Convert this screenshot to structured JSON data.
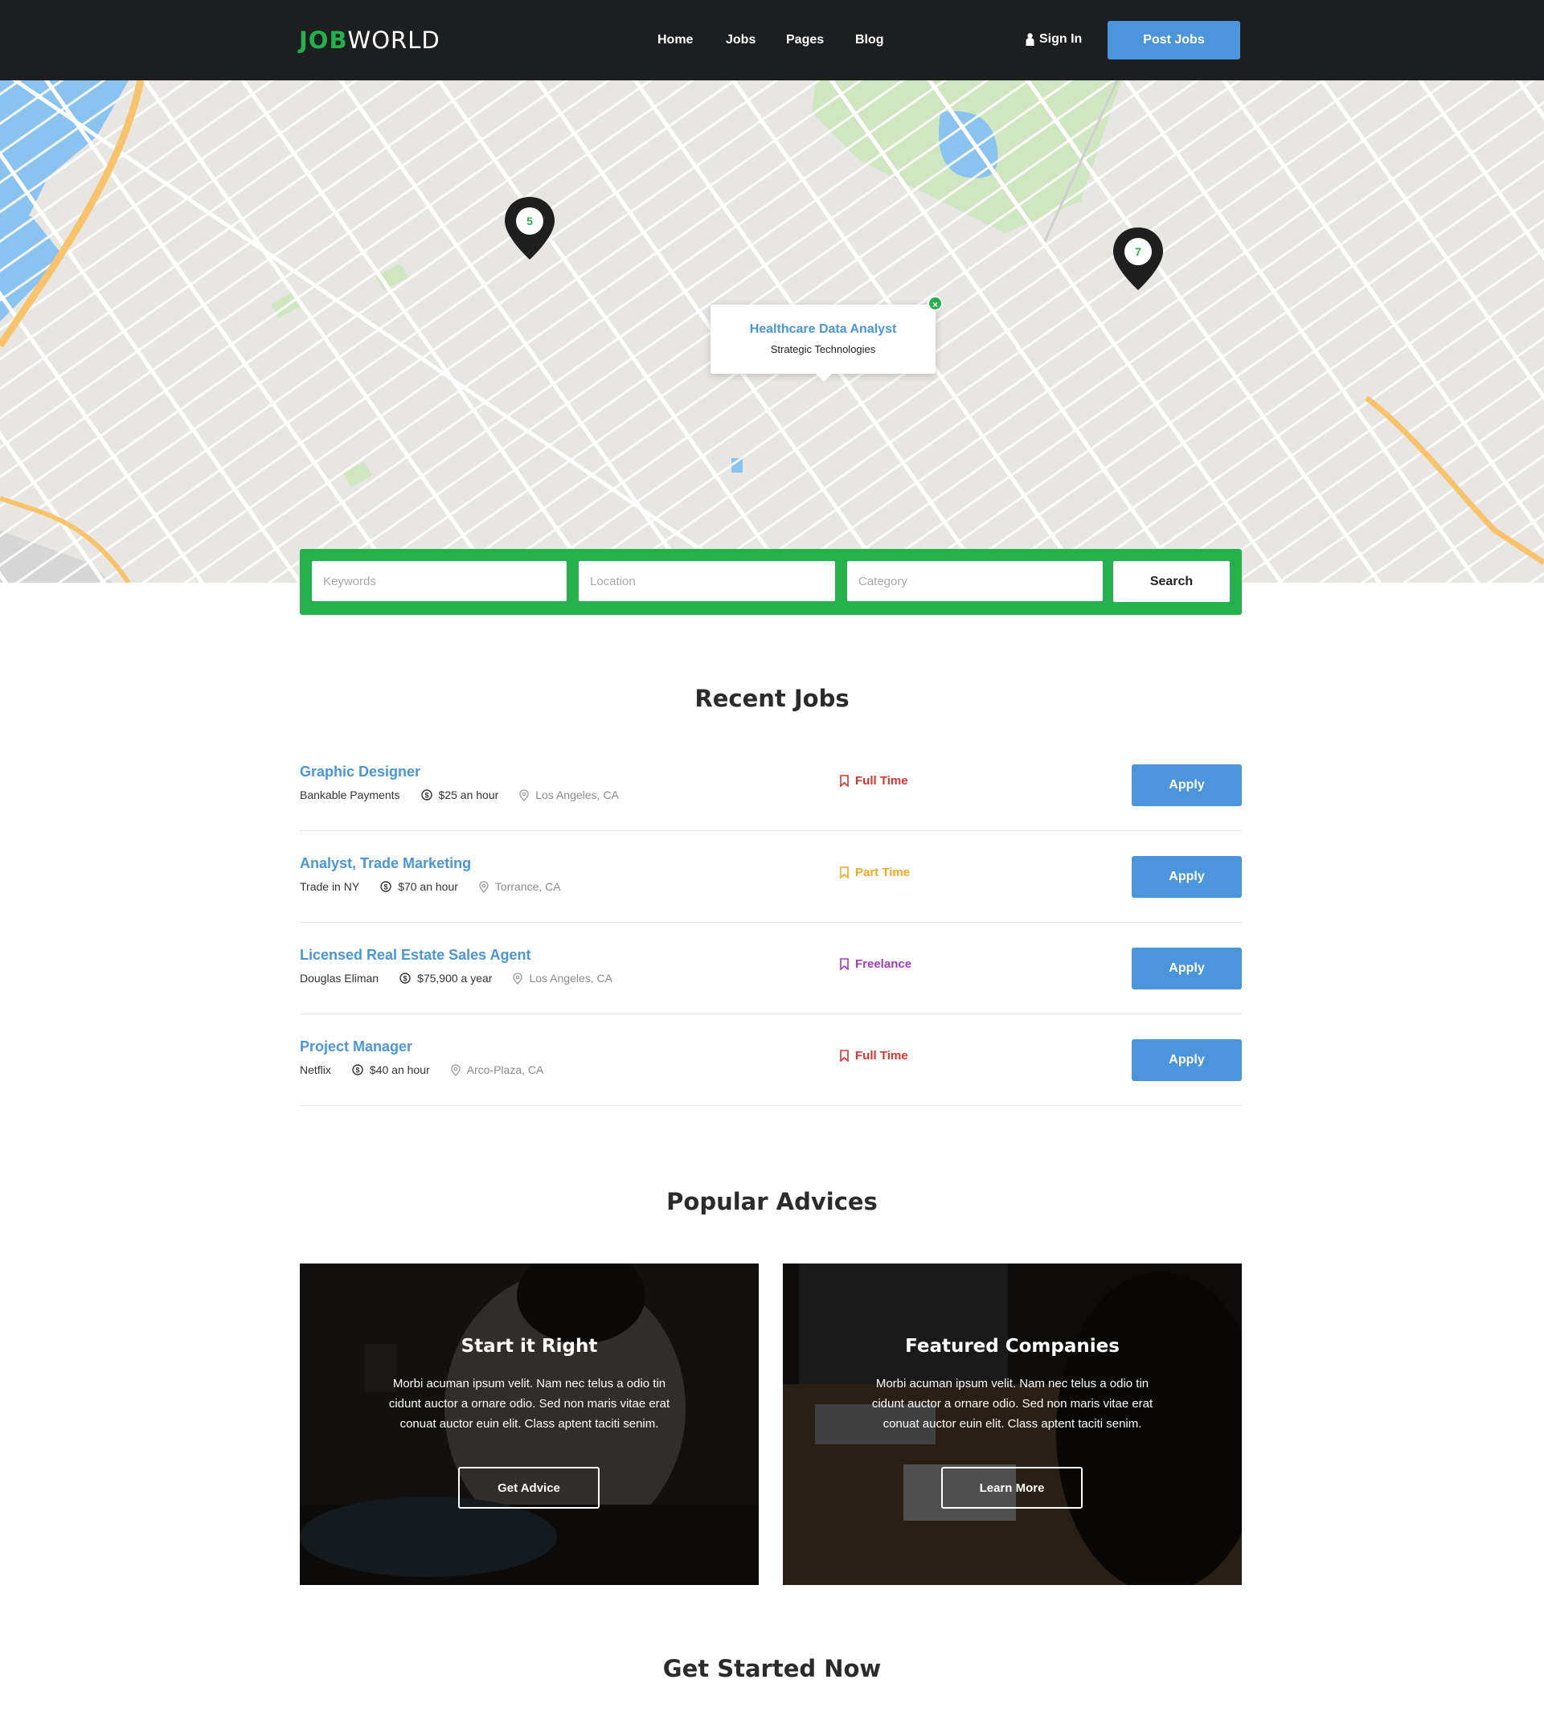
{
  "header": {
    "logo_job": "JOB",
    "logo_world": "WORLD",
    "nav": [
      "Home",
      "Jobs",
      "Pages",
      "Blog"
    ],
    "sign_in": "Sign In",
    "post_jobs": "Post Jobs"
  },
  "map": {
    "cluster_left_count": "5",
    "cluster_right_count": "7",
    "popup": {
      "title": "Healthcare Data Analyst",
      "company": "Strategic Technologies"
    }
  },
  "search": {
    "keywords_placeholder": "Keywords",
    "location_placeholder": "Location",
    "category_placeholder": "Category",
    "button": "Search"
  },
  "recent_jobs": {
    "title": "Recent Jobs",
    "apply_label": "Apply",
    "jobs": [
      {
        "title": "Graphic Designer",
        "company": "Bankable Payments",
        "salary": "$25 an hour",
        "location": "Los Angeles, CA",
        "type": "Full Time",
        "type_color": "#e0322d"
      },
      {
        "title": "Analyst, Trade Marketing",
        "company": "Trade in NY",
        "salary": "$70 an hour",
        "location": "Torrance, CA",
        "type": "Part Time",
        "type_color": "#f5a623"
      },
      {
        "title": "Licensed Real Estate Sales Agent",
        "company": "Douglas Eliman",
        "salary": "$75,900 a year",
        "location": "Los Angeles, CA",
        "type": "Freelance",
        "type_color": "#a63cbf"
      },
      {
        "title": "Project Manager",
        "company": "Netflix",
        "salary": "$40 an hour",
        "location": "Arco-Plaza, CA",
        "type": "Full Time",
        "type_color": "#e0322d"
      }
    ]
  },
  "advices": {
    "title": "Popular Advices",
    "cards": [
      {
        "title": "Start it Right",
        "text": "Morbi acuman ipsum velit. Nam nec telus a odio tin cidunt auctor a ornare odio. Sed non  maris vitae erat conuat auctor euin elit. Class aptent taciti senim.",
        "button": "Get Advice"
      },
      {
        "title": "Featured Companies",
        "text": "Morbi acuman ipsum velit. Nam nec telus a odio tin cidunt auctor a ornare odio. Sed non  maris vitae erat conuat auctor euin elit. Class aptent taciti senim.",
        "button": "Learn More"
      }
    ]
  },
  "get_started": {
    "title": "Get Started Now"
  },
  "colors": {
    "brand_green": "#24b04b",
    "accent_blue": "#4a95db",
    "header_bg": "#1d1e20"
  },
  "icons": {
    "user": "user-icon",
    "dollar": "dollar-icon",
    "location": "map-pin-icon",
    "job_type": "bookmark-icon",
    "close": "close-icon"
  }
}
